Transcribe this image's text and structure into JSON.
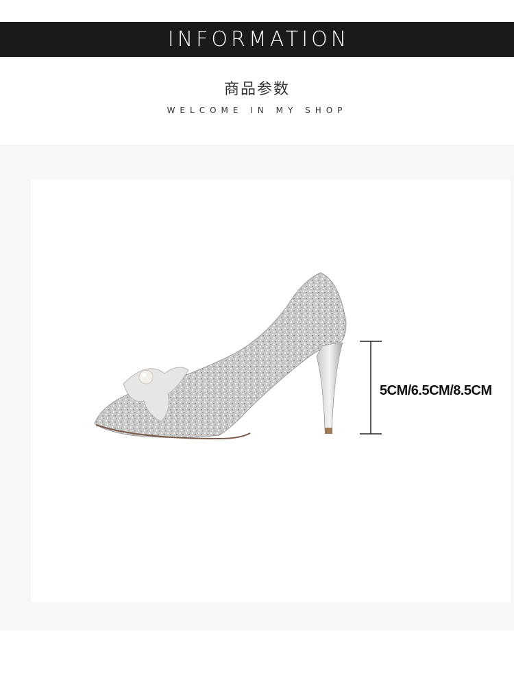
{
  "header": {
    "banner_title": "INFORMATION",
    "subtitle_cn": "商品参数",
    "subtitle_en": "WELCOME IN MY SHOP"
  },
  "product": {
    "image_icon": "silver-glitter-pointed-heel-pump-with-pearl-bow",
    "heel_height_label": "5CM/6.5CM/8.5CM"
  },
  "colors": {
    "banner_bg": "#1a1a1a",
    "panel_bg": "#f7f7f7",
    "text": "#333333"
  }
}
